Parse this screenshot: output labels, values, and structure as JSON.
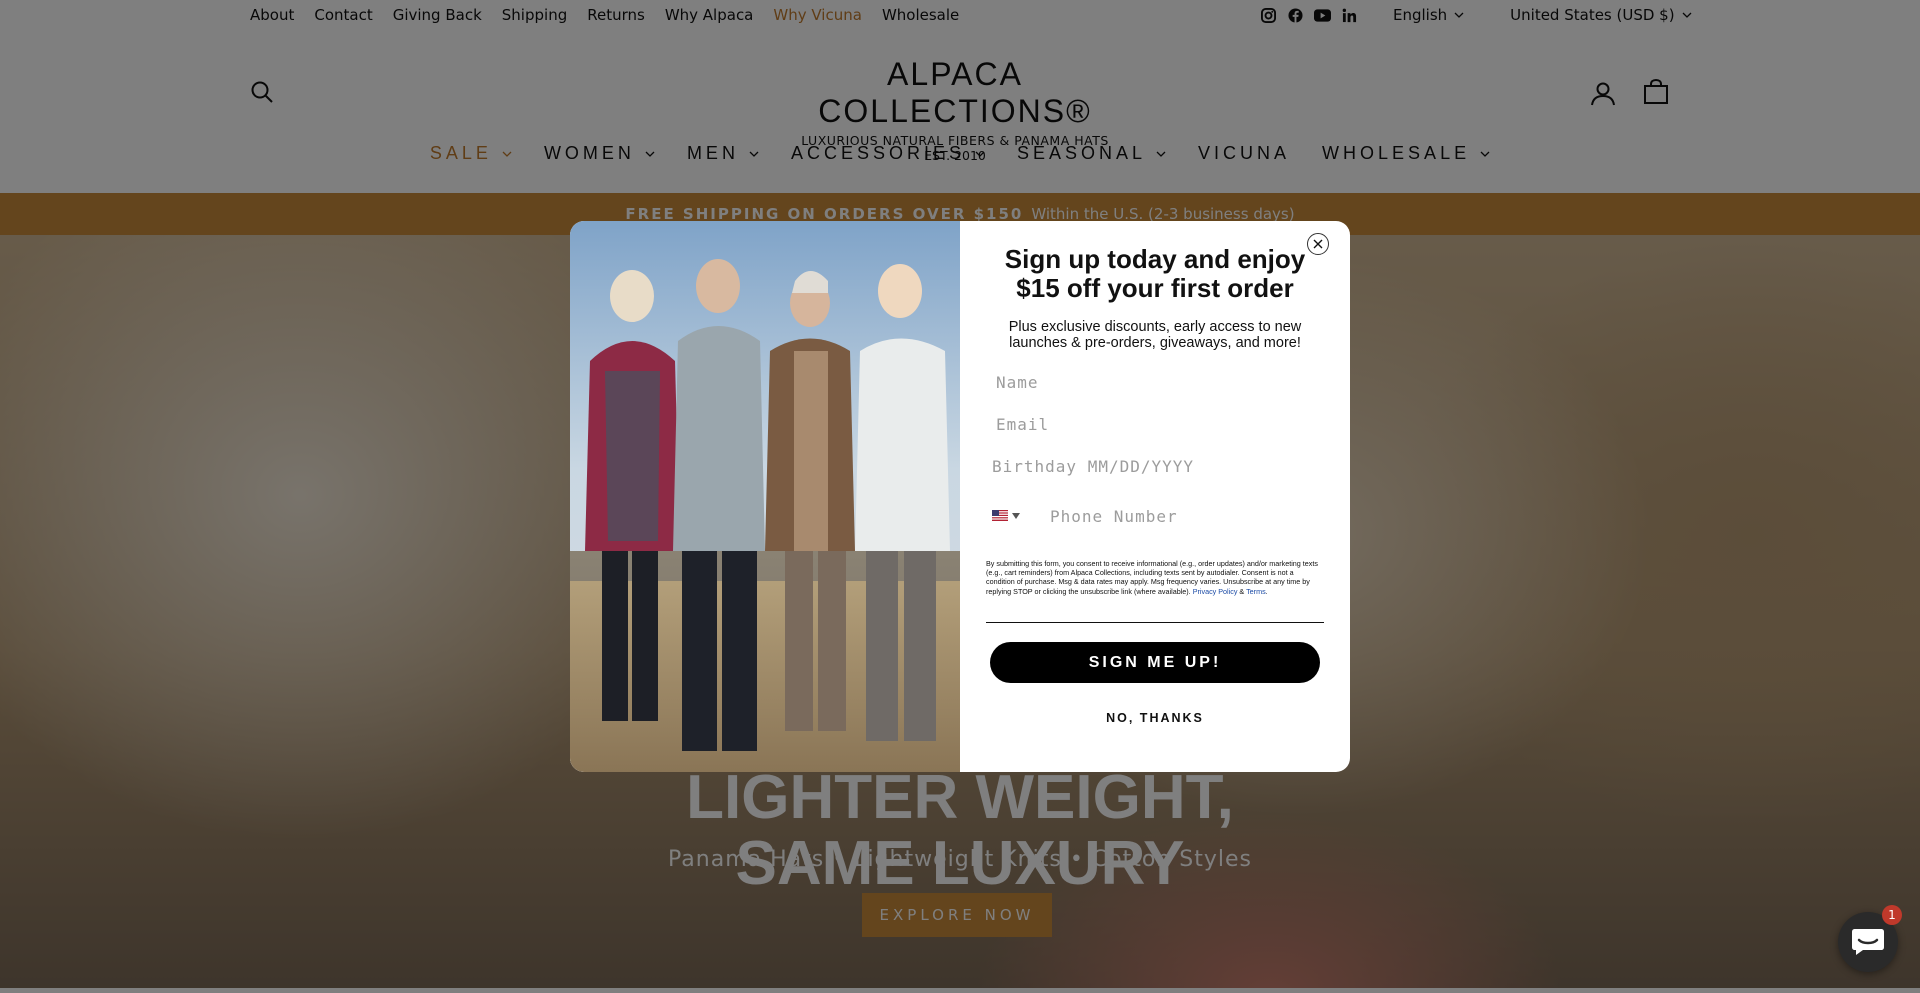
{
  "utility_links": [
    "About",
    "Contact",
    "Giving Back",
    "Shipping",
    "Returns",
    "Why Alpaca",
    "Why Vicuna",
    "Wholesale"
  ],
  "active_utility_link": "Why Vicuna",
  "social": [
    "instagram-icon",
    "facebook-icon",
    "youtube-icon",
    "linkedin-icon"
  ],
  "language": "English",
  "currency": "United States (USD $)",
  "logo": {
    "main": "ALPACA  COLLECTIONS®",
    "tagline": "LUXURIOUS NATURAL FIBERS & PANAMA HATS",
    "est": "EST. 2010"
  },
  "nav": [
    "SALE",
    "WOMEN",
    "MEN",
    "ACCESSORIES",
    "SEASONAL",
    "VICUNA",
    "WHOLESALE"
  ],
  "promo": {
    "strong": "FREE SHIPPING ON ORDERS OVER $150",
    "rest": "Within the U.S. (2-3 business days)"
  },
  "hero": {
    "title_partial": "LIGHTER WEIGHT,",
    "title_line2": "SAME LUXURY",
    "subtitle": "Panama Hats • Lightweight Knits • Cotton Styles",
    "cta": "EXPLORE NOW"
  },
  "popup": {
    "title": "Sign up today and enjoy $15 off your first order",
    "description": "Plus exclusive discounts, early access to new launches & pre-orders, giveaways, and more!",
    "fields": {
      "name_placeholder": "Name",
      "email_placeholder": "Email",
      "birthday_placeholder": "Birthday MM/DD/YYYY",
      "phone_placeholder": "Phone Number"
    },
    "legal": "By submitting this form, you consent to receive informational (e.g., order updates) and/or marketing texts (e.g., cart reminders) from Alpaca Collections, including texts sent by autodialer. Consent is not a condition of purchase. Msg & data rates may apply. Msg frequency varies. Unsubscribe at any time by replying STOP or clicking the unsubscribe link (where available).",
    "privacy_link": "Privacy Policy",
    "amp": "&",
    "terms_link": "Terms",
    "submit": "SIGN ME UP!",
    "decline": "NO, THANKS"
  },
  "chat": {
    "badge": "1"
  },
  "colors": {
    "accent": "#c98a3a",
    "active_link": "#c07a2c",
    "button": "#000000"
  }
}
